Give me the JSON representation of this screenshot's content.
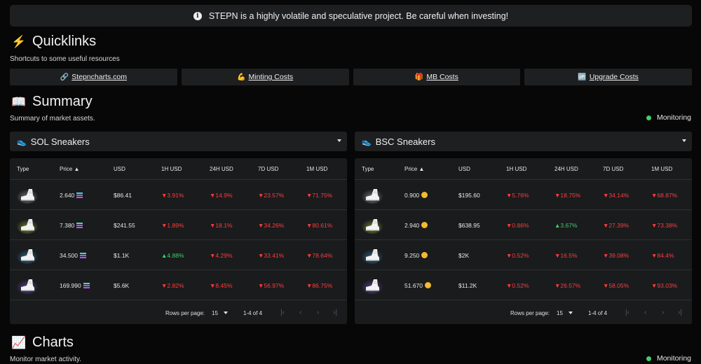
{
  "banner": {
    "text": "STEPN is a highly volatile and speculative project. Be careful when investing!"
  },
  "quicklinks": {
    "title": "Quicklinks",
    "subtitle": "Shortcuts to some useful resources",
    "links": [
      {
        "icon": "🔗",
        "label": "Stepncharts.com"
      },
      {
        "icon": "💪",
        "label": "Minting Costs"
      },
      {
        "icon": "🎁",
        "label": "MB Costs"
      },
      {
        "icon": "🆙",
        "label": "Upgrade Costs"
      }
    ]
  },
  "summary": {
    "title": "Summary",
    "subtitle": "Summary of market assets.",
    "monitoring": "Monitoring"
  },
  "charts": {
    "title": "Charts",
    "subtitle": "Monitor market activity.",
    "monitoring": "Monitoring"
  },
  "tables": [
    {
      "select": "SOL Sneakers",
      "headers": [
        "Type",
        "Price ▲",
        "USD",
        "1H USD",
        "24H USD",
        "7D USD",
        "1M USD"
      ],
      "rows": [
        {
          "price": "2.640",
          "usd": "$86.41",
          "h1": "▼3.91%",
          "h24": "▼14.9%",
          "d7": "▼23.57%",
          "m1": "▼71.75%",
          "h1_dir": "down",
          "h24_dir": "down",
          "d7_dir": "down",
          "m1_dir": "down",
          "glow": "#bbbbbb"
        },
        {
          "price": "7.380",
          "usd": "$241.55",
          "h1": "▼1.89%",
          "h24": "▼18.1%",
          "d7": "▼34.26%",
          "m1": "▼80.61%",
          "h1_dir": "down",
          "h24_dir": "down",
          "d7_dir": "down",
          "m1_dir": "down",
          "glow": "#b5e03a"
        },
        {
          "price": "34.500",
          "usd": "$1.1K",
          "h1": "▲4.88%",
          "h24": "▼4.29%",
          "d7": "▼33.41%",
          "m1": "▼78.64%",
          "h1_dir": "up",
          "h24_dir": "down",
          "d7_dir": "down",
          "m1_dir": "down",
          "glow": "#3aa6e8"
        },
        {
          "price": "169.990",
          "usd": "$5.6K",
          "h1": "▼2.82%",
          "h24": "▼8.45%",
          "d7": "▼56.97%",
          "m1": "▼86.75%",
          "h1_dir": "down",
          "h24_dir": "down",
          "d7_dir": "down",
          "m1_dir": "down",
          "glow": "#8a5ae8"
        }
      ],
      "coin": "sol",
      "footer": {
        "rows_label": "Rows per page:",
        "rows_value": "15",
        "range": "1-4 of 4"
      }
    },
    {
      "select": "BSC Sneakers",
      "headers": [
        "Type",
        "Price ▲",
        "USD",
        "1H USD",
        "24H USD",
        "7D USD",
        "1M USD"
      ],
      "rows": [
        {
          "price": "0.900",
          "usd": "$195.60",
          "h1": "▼5.76%",
          "h24": "▼18.75%",
          "d7": "▼34.14%",
          "m1": "▼68.87%",
          "h1_dir": "down",
          "h24_dir": "down",
          "d7_dir": "down",
          "m1_dir": "down",
          "glow": "#bbbbbb"
        },
        {
          "price": "2.940",
          "usd": "$638.95",
          "h1": "▼0.86%",
          "h24": "▲3.67%",
          "d7": "▼27.39%",
          "m1": "▼73.38%",
          "h1_dir": "down",
          "h24_dir": "up",
          "d7_dir": "down",
          "m1_dir": "down",
          "glow": "#b5e03a"
        },
        {
          "price": "9.250",
          "usd": "$2K",
          "h1": "▼0.52%",
          "h24": "▼16.5%",
          "d7": "▼39.08%",
          "m1": "▼84.4%",
          "h1_dir": "down",
          "h24_dir": "down",
          "d7_dir": "down",
          "m1_dir": "down",
          "glow": "#3aa6e8"
        },
        {
          "price": "51.670",
          "usd": "$11.2K",
          "h1": "▼0.52%",
          "h24": "▼26.57%",
          "d7": "▼58.05%",
          "m1": "▼93.03%",
          "h1_dir": "down",
          "h24_dir": "down",
          "d7_dir": "down",
          "m1_dir": "down",
          "glow": "#8a5ae8"
        }
      ],
      "coin": "bnb",
      "footer": {
        "rows_label": "Rows per page:",
        "rows_value": "15",
        "range": "1-4 of 4"
      }
    }
  ],
  "colors": {
    "down": "#ff3b3b",
    "up": "#3ecf6a",
    "panel": "#1a1b1d",
    "background": "#070707"
  }
}
